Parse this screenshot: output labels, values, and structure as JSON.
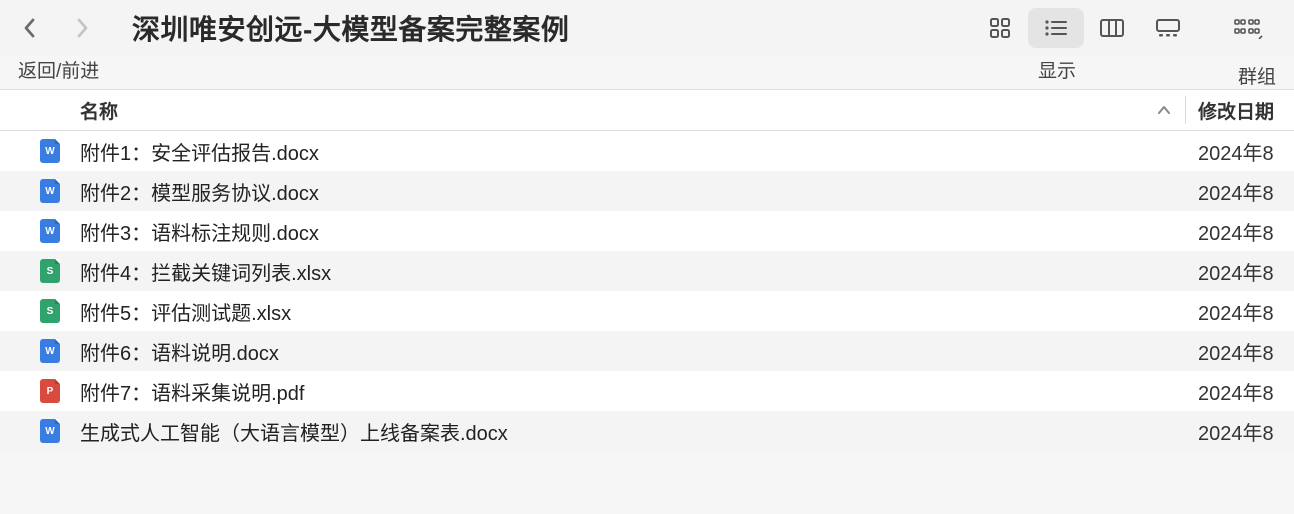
{
  "toolbar": {
    "back_forward_label": "返回/前进",
    "title": "深圳唯安创远-大模型备案完整案例",
    "view_label": "显示",
    "group_label": "群组"
  },
  "columns": {
    "name": "名称",
    "modified": "修改日期"
  },
  "files": [
    {
      "name": "附件1：安全评估报告.docx",
      "type": "docx",
      "glyph": "W",
      "date": "2024年8"
    },
    {
      "name": "附件2：模型服务协议.docx",
      "type": "docx",
      "glyph": "W",
      "date": "2024年8"
    },
    {
      "name": "附件3：语料标注规则.docx",
      "type": "docx",
      "glyph": "W",
      "date": "2024年8"
    },
    {
      "name": "附件4：拦截关键词列表.xlsx",
      "type": "xlsx",
      "glyph": "S",
      "date": "2024年8"
    },
    {
      "name": "附件5：评估测试题.xlsx",
      "type": "xlsx",
      "glyph": "S",
      "date": "2024年8"
    },
    {
      "name": "附件6：语料说明.docx",
      "type": "docx",
      "glyph": "W",
      "date": "2024年8"
    },
    {
      "name": "附件7：语料采集说明.pdf",
      "type": "pdf",
      "glyph": "P",
      "date": "2024年8"
    },
    {
      "name": "生成式人工智能（大语言模型）上线备案表.docx",
      "type": "docx",
      "glyph": "W",
      "date": "2024年8"
    }
  ]
}
